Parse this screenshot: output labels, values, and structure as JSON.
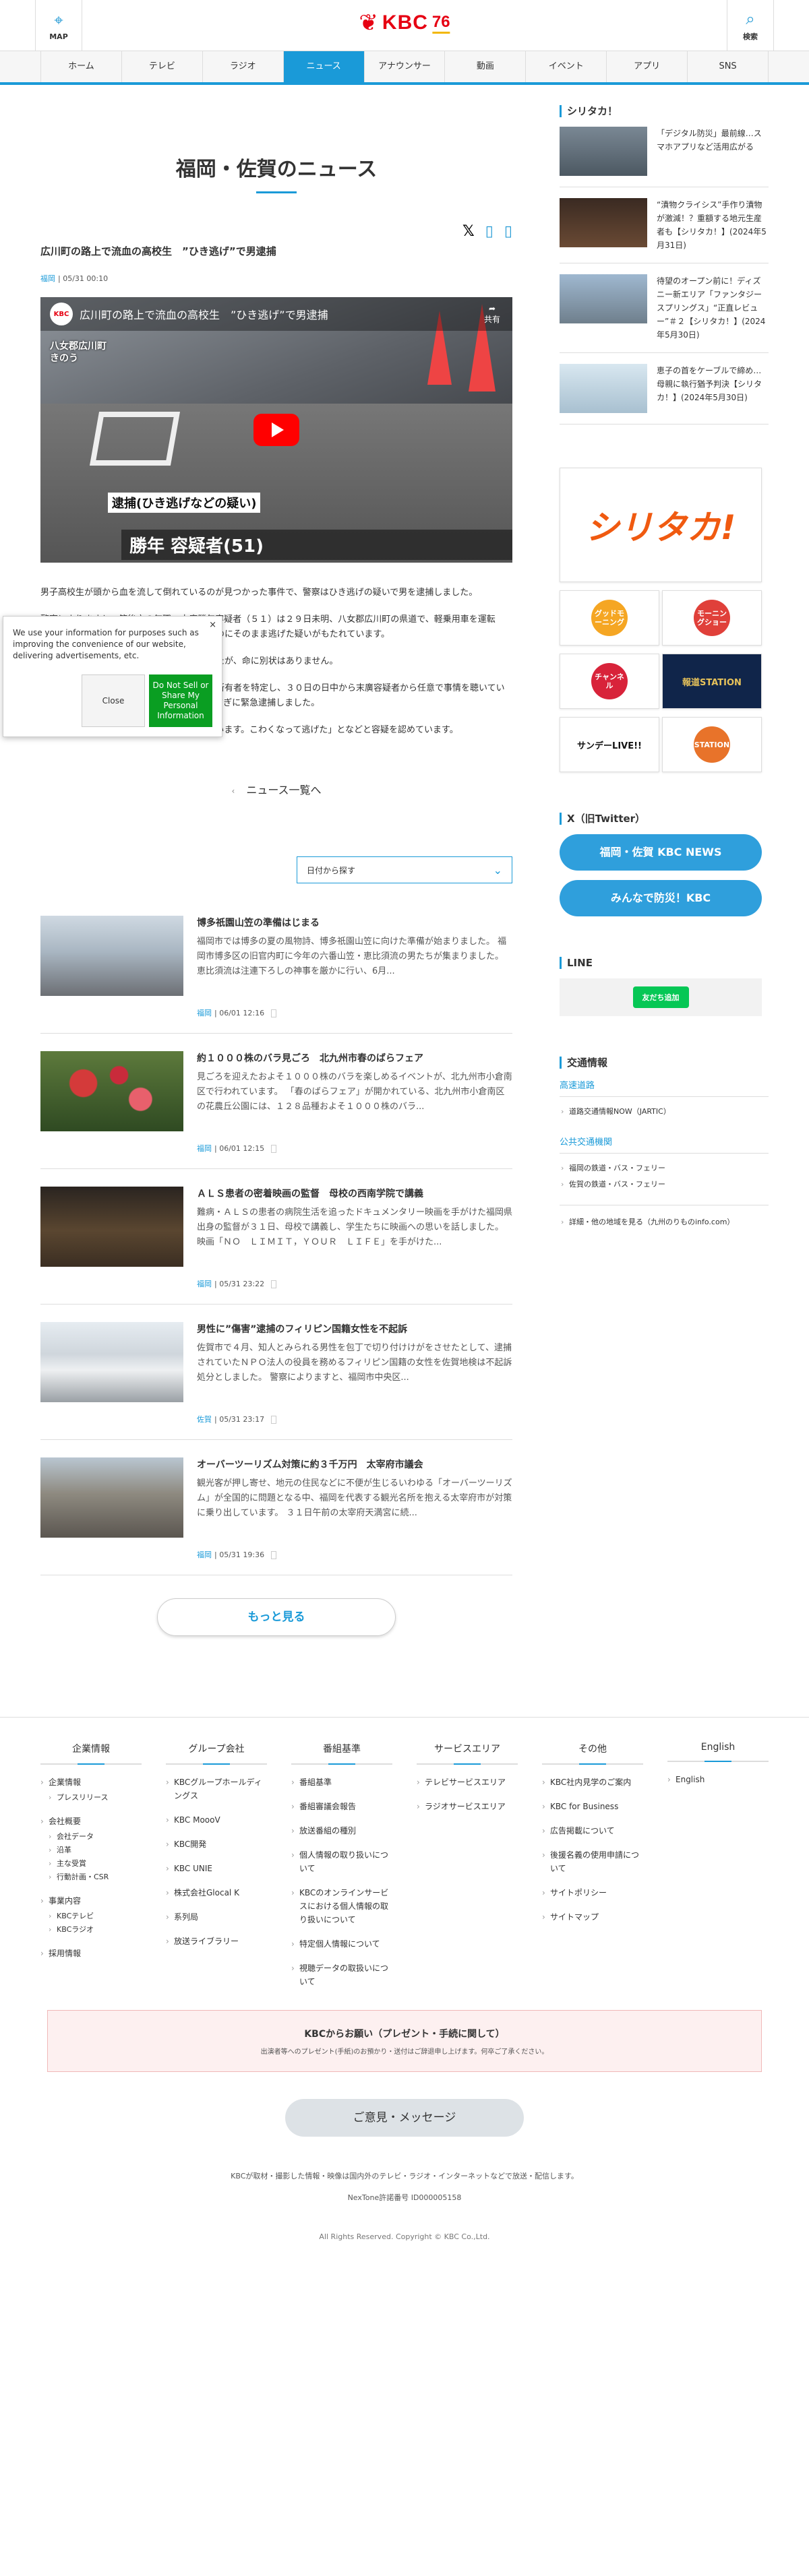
{
  "header": {
    "map_label": "MAP",
    "search_label": "検索",
    "logo_text": "KBC",
    "anniversary": "76"
  },
  "nav": [
    "ホーム",
    "テレビ",
    "ラジオ",
    "ニュース",
    "アナウンサー",
    "動画",
    "イベント",
    "アプリ",
    "SNS"
  ],
  "page_title": "福岡・佐賀のニュース",
  "article": {
    "title": "広川町の路上で流血の高校生　”ひき逃げ”で男逮捕",
    "category": "福岡",
    "datetime": "05/31 00:10",
    "video": {
      "title": "広川町の路上で流血の高校生　”ひき逃げ”で男逮捕",
      "badge": "八女郡広川町\nきのう",
      "caption1": "逮捕(ひき逃げなどの疑い)",
      "caption2": "勝年 容疑者(51)",
      "share": "共有"
    },
    "paragraphs": [
      "男子高校生が頭から血を流して倒れているのが見つかった事件で、警察はひき逃げの疑いで男を逮捕しました。",
      "警察によりますと、筑後市の無職・末廣勝年容疑者（５１）は２９日未明、八女郡広川町の県道で、軽乗用車を運転中、１５歳の男子高校生をはねけがをさせたのにそのまま逃げた疑いがもたれています。",
      "男子高校生は骨盤骨折などの重傷を負いましたが、命に別状はありません。",
      "警察は防犯カメラの映像などから車の種類や所有者を特定し、３０日の日中から末廣容疑者から任意で事情を聴いていましたが、容疑が固まったとして、夕方５時すぎに緊急逮捕しました。",
      "「助けなかったことについてはその通りと思います。こわくなって逃げた」となどと容疑を認めています。"
    ]
  },
  "to_list": "ニュース一覧へ",
  "filter_label": "日付から探す",
  "news": [
    {
      "title": "博多祇園山笠の準備はじまる",
      "desc": "福岡市では博多の夏の風物詩、博多祇園山笠に向けた準備が始まりました。 福岡市博多区の旧官内町に今年の六番山笠・恵比須流の男たちが集まりました。 恵比須流は注連下ろしの神事を厳かに行い、6月...",
      "category": "福岡",
      "datetime": "06/01 12:16"
    },
    {
      "title": "約１０００株のバラ見ごろ　北九州市春のばらフェア",
      "desc": "見ごろを迎えたおよそ１０００株のバラを楽しめるイベントが、北九州市小倉南区で行われています。 「春のばらフェア」が開かれている、北九州市小倉南区の花農丘公園には、１２８品種およそ１０００株のバラ...",
      "category": "福岡",
      "datetime": "06/01 12:15"
    },
    {
      "title": "ＡＬＳ患者の密着映画の監督　母校の西南学院で講義",
      "desc": "難病・ＡＬＳの患者の病院生活を追ったドキュメンタリー映画を手がけた福岡県出身の監督が３１日、母校で講義し、学生たちに映画への思いを話しました。 映画「ＮＯ　ＬＩＭＩＴ，ＹＯＵＲ　ＬＩＦＥ」を手がけた...",
      "category": "福岡",
      "datetime": "05/31 23:22"
    },
    {
      "title": "男性に”傷害”逮捕のフィリピン国籍女性を不起訴",
      "desc": "佐賀市で４月、知人とみられる男性を包丁で切り付けけがをさせたとして、逮捕されていたＮＰＯ法人の役員を務めるフィリピン国籍の女性を佐賀地検は不起訴処分としました。 警察によりますと、福岡市中央区...",
      "category": "佐賀",
      "datetime": "05/31 23:17"
    },
    {
      "title": "オーバーツーリズム対策に約３千万円　太宰府市議会",
      "desc": "観光客が押し寄せ、地元の住民などに不便が生じるいわゆる「オーバーツーリズム」が全国的に問題となる中、福岡を代表する観光名所を抱える太宰府市が対策に乗り出しています。 ３１日午前の太宰府天満宮に続...",
      "category": "福岡",
      "datetime": "05/31 19:36"
    }
  ],
  "more_label": "もっと見る",
  "cookie": {
    "text": "We use your information for purposes such as improving the convenience of our website, delivering advertisements, etc.",
    "close": "Close",
    "dns": "Do Not Sell or Share My Personal Information"
  },
  "sidebar": {
    "shiritaka_heading": "シリタカ！",
    "shiritaka_items": [
      "「デジタル防災」最前線…スマホアプリなど活用広がる",
      "“漬物クライシス”手作り漬物が激減！？重額する地元生産者も【シリタカ！】(2024年5月31日)",
      "待望のオープン前に！ディズニー新エリア「ファンタジースプリングス」“正直レビュー”＃２【シリタカ！】(2024年5月30日)",
      "恵子の首をケーブルで締め…母親に執行猶予判決【シリタカ！】(2024年5月30日)"
    ],
    "banner_big": "シリタカ!",
    "banners": [
      "グッドモーニング",
      "モーニングショー",
      "チャンネル",
      "報道STATION",
      "サンデーLIVE!!",
      "STATION"
    ],
    "x_heading": "X（旧Twitter）",
    "x_buttons": [
      "福岡・佐賀 KBC NEWS",
      "みんなで防災！KBC"
    ],
    "line_heading": "LINE",
    "line_button": "友だち追加",
    "traffic_heading": "交通情報",
    "highway_heading": "高速道路",
    "highway_items": [
      "道路交通情報NOW（JARTIC）"
    ],
    "transit_heading": "公共交通機関",
    "transit_items": [
      "福岡の鉄道・バス・フェリー",
      "佐賀の鉄道・バス・フェリー"
    ],
    "traffic_more": "詳細・他の地域を見る（九州のりものinfo.com）"
  },
  "footer": {
    "columns": [
      {
        "title": "企業情報",
        "items": [
          {
            "label": "企業情報",
            "sub": [
              "プレスリリース"
            ]
          },
          {
            "label": "会社概要",
            "sub": [
              "会社データ",
              "沿革",
              "主な受賞",
              "行動計画・CSR"
            ]
          },
          {
            "label": "事業内容",
            "sub": [
              "KBCテレビ",
              "KBCラジオ"
            ]
          },
          {
            "label": "採用情報",
            "sub": []
          }
        ]
      },
      {
        "title": "グループ会社",
        "items": [
          {
            "label": "KBCグループホールディングス",
            "sub": []
          },
          {
            "label": "KBC MoooV",
            "sub": []
          },
          {
            "label": "KBC開発",
            "sub": []
          },
          {
            "label": "KBC UNIE",
            "sub": []
          },
          {
            "label": "株式会社Glocal K",
            "sub": []
          },
          {
            "label": "系列局",
            "sub": []
          },
          {
            "label": "放送ライブラリー",
            "sub": []
          }
        ]
      },
      {
        "title": "番組基準",
        "items": [
          {
            "label": "番組基準",
            "sub": []
          },
          {
            "label": "番組審議会報告",
            "sub": []
          },
          {
            "label": "放送番組の種別",
            "sub": []
          },
          {
            "label": "個人情報の取り扱いについて",
            "sub": []
          },
          {
            "label": "KBCのオンラインサービスにおける個人情報の取り扱いについて",
            "sub": []
          },
          {
            "label": "特定個人情報について",
            "sub": []
          },
          {
            "label": "視聴データの取扱いについて",
            "sub": []
          }
        ]
      },
      {
        "title": "サービスエリア",
        "items": [
          {
            "label": "テレビサービスエリア",
            "sub": []
          },
          {
            "label": "ラジオサービスエリア",
            "sub": []
          }
        ]
      },
      {
        "title": "その他",
        "items": [
          {
            "label": "KBC社内見学のご案内",
            "sub": []
          },
          {
            "label": "KBC for Business",
            "sub": []
          },
          {
            "label": "広告掲載について",
            "sub": []
          },
          {
            "label": "後援名義の使用申請について",
            "sub": []
          },
          {
            "label": "サイトポリシー",
            "sub": []
          },
          {
            "label": "サイトマップ",
            "sub": []
          }
        ]
      },
      {
        "title": "English",
        "items": [
          {
            "label": "English",
            "sub": []
          }
        ]
      }
    ],
    "notice_title": "KBCからお願い（プレゼント・手続に関して）",
    "notice_text": "出演者等へのプレゼント(手紙)のお預かり・送付はご辞退申し上げます。何卒ご了承ください。",
    "opinion": "ご意見・メッセージ",
    "note": "KBCが取材・撮影した情報・映像は国内外のテレビ・ラジオ・インターネットなどで放送・配信します。",
    "nextone": "NexTone許諾番号 ID000005158",
    "copyright": "All Rights Reserved. Copyright © KBC Co.,Ltd."
  }
}
